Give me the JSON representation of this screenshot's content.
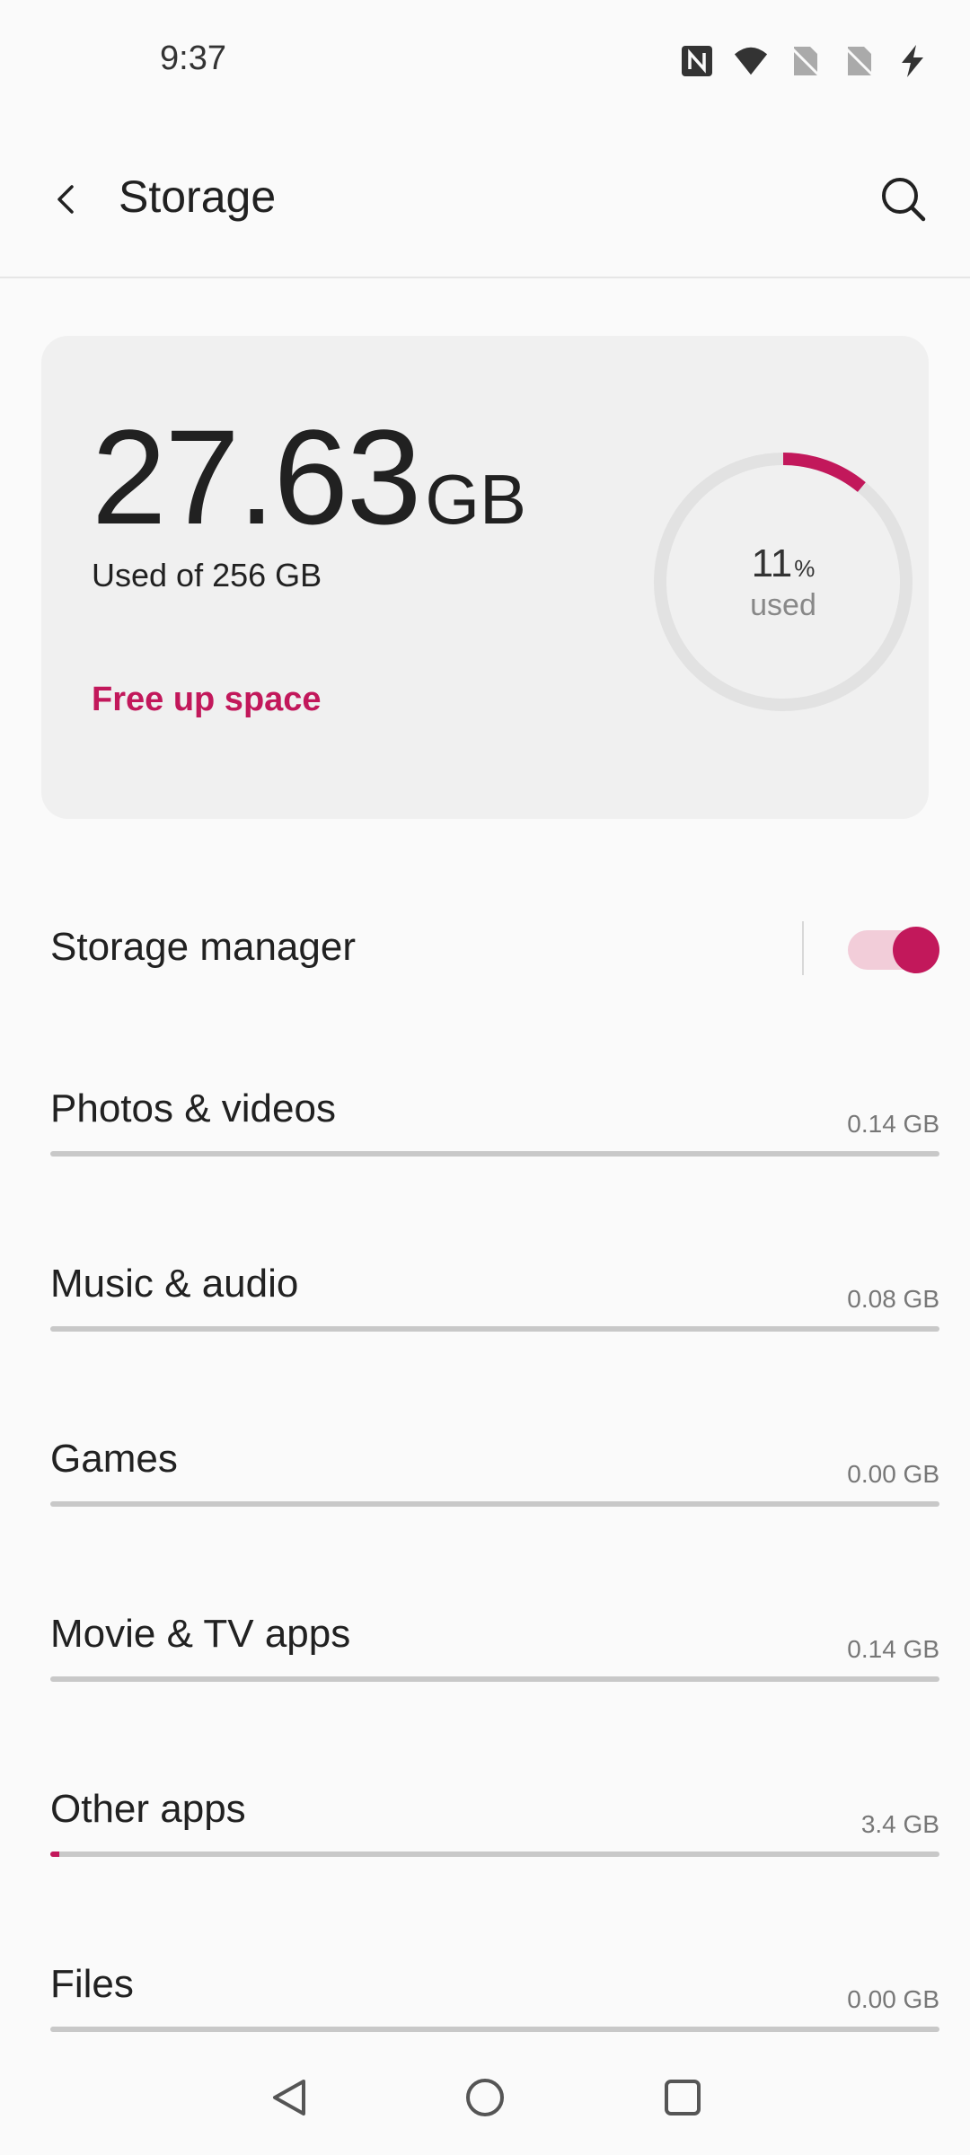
{
  "status_bar": {
    "time": "9:37",
    "icons": [
      "nfc-icon",
      "wifi-icon",
      "no-sim-icon",
      "no-sim-icon",
      "charging-icon"
    ]
  },
  "app_bar": {
    "title": "Storage",
    "back_icon": "back-arrow-icon",
    "search_icon": "search-icon"
  },
  "summary": {
    "used_value": "27.63",
    "used_unit": "GB",
    "used_of": "Used of 256 GB",
    "free_up": "Free up space",
    "percent": "11",
    "percent_sign": "%",
    "percent_label": "used",
    "percent_fraction": 0.11
  },
  "storage_manager": {
    "label": "Storage manager",
    "enabled": true
  },
  "categories": [
    {
      "label": "Photos & videos",
      "size": "0.14 GB",
      "fraction": 0.0
    },
    {
      "label": "Music & audio",
      "size": "0.08 GB",
      "fraction": 0.0
    },
    {
      "label": "Games",
      "size": "0.00 GB",
      "fraction": 0.0
    },
    {
      "label": "Movie & TV apps",
      "size": "0.14 GB",
      "fraction": 0.0
    },
    {
      "label": "Other apps",
      "size": "3.4 GB",
      "fraction": 0.01
    },
    {
      "label": "Files",
      "size": "0.00 GB",
      "fraction": 0.0
    }
  ],
  "nav_bar": {
    "icons": [
      "back-triangle-icon",
      "home-circle-icon",
      "recents-square-icon"
    ]
  },
  "colors": {
    "accent": "#c2185b",
    "track": "#e2e2e2",
    "switch_track": "#f2cdd9"
  }
}
